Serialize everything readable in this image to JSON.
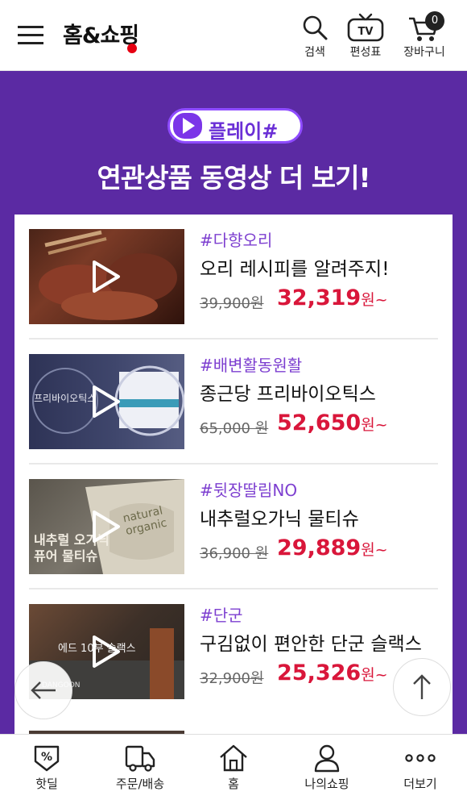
{
  "header": {
    "logo": "홈&쇼핑",
    "search_label": "검색",
    "schedule_label": "편성표",
    "schedule_icon_text": "TV",
    "cart_label": "장바구니",
    "cart_count": "0"
  },
  "promo": {
    "brand": "플레이#",
    "title": "연관상품 동영상 더 보기!"
  },
  "items": [
    {
      "tag": "#다향오리",
      "name": "오리 레시피를 알려주지!",
      "orig_price": "39,900원",
      "price": "32,319",
      "suffix": "원~"
    },
    {
      "tag": "#배변활동원활",
      "name": "종근당 프리바이오틱스",
      "orig_price": "65,000 원",
      "price": "52,650",
      "suffix": "원~",
      "thumb_text": "프리바이오틱스"
    },
    {
      "tag": "#뒷장딸림NO",
      "name": "내추럴오가닉 물티슈",
      "orig_price": "36,900 원",
      "price": "29,889",
      "suffix": "원~",
      "thumb_text": "내추럴 오가닉\n퓨어 물티슈"
    },
    {
      "tag": "#단군",
      "name": "구김없이 편안한 단군 슬랙스",
      "orig_price": "32,900원",
      "price": "25,326",
      "suffix": "원~",
      "thumb_text": "에드 10부 슬랙스"
    }
  ],
  "tabs": [
    {
      "label": "핫딜",
      "icon": "hotdeal-percent-icon"
    },
    {
      "label": "주문/배송",
      "icon": "delivery-icon"
    },
    {
      "label": "홈",
      "icon": "home-icon"
    },
    {
      "label": "나의쇼핑",
      "icon": "person-icon"
    },
    {
      "label": "더보기",
      "icon": "more-dots-icon"
    }
  ],
  "colors": {
    "brand_purple": "#5b2aa3",
    "price_red": "#d9163a",
    "tag_purple": "#7d3fd0"
  }
}
